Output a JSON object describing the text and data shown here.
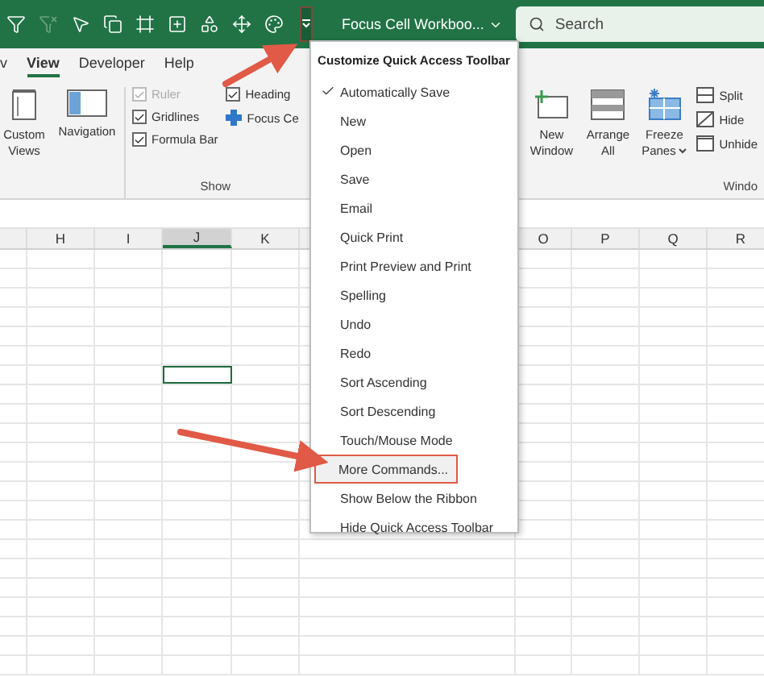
{
  "title_bar": {
    "customize_button": {
      "selected": true
    },
    "title": "Focus Cell Workboo...",
    "search": {
      "placeholder": "Search"
    }
  },
  "tabs": [
    {
      "label": "v",
      "selected": false
    },
    {
      "label": "View",
      "selected": true
    },
    {
      "label": "Developer",
      "selected": false
    },
    {
      "label": "Help",
      "selected": false
    }
  ],
  "ribbon": {
    "left_buttons": [
      {
        "label": "Custom Views",
        "kind": "views"
      },
      {
        "label": "Navigation",
        "kind": "navigation"
      }
    ],
    "show_checks": [
      {
        "label": "Ruler",
        "checked": true,
        "disabled": true
      },
      {
        "label": "Gridlines",
        "checked": true,
        "disabled": false
      },
      {
        "label": "Formula Bar",
        "checked": true,
        "disabled": false
      }
    ],
    "show_extra": [
      {
        "label": "Heading",
        "kind": "checkbox",
        "checked": true
      },
      {
        "label": "Focus Ce",
        "kind": "addin"
      }
    ],
    "show_group_label": "Show",
    "window_buttons": [
      {
        "label": "New Window",
        "kind": "new"
      },
      {
        "label": "Arrange All",
        "kind": "arrange"
      },
      {
        "label": "Freeze Panes",
        "kind": "freeze",
        "dropdown": true
      }
    ],
    "window_small": [
      {
        "label": "Split",
        "kind": "split"
      },
      {
        "label": "Hide",
        "kind": "hide"
      },
      {
        "label": "Unhide",
        "kind": "unhide"
      }
    ],
    "window_group_label": "Windo"
  },
  "sheet": {
    "columns_left": [
      {
        "label": "H",
        "selected": false
      },
      {
        "label": "I",
        "selected": false
      },
      {
        "label": "J",
        "selected": true
      },
      {
        "label": "K",
        "selected": false
      }
    ],
    "columns_right": [
      {
        "label": "O",
        "selected": false
      },
      {
        "label": "P",
        "selected": false
      },
      {
        "label": "Q",
        "selected": false
      },
      {
        "label": "R",
        "selected": false
      }
    ],
    "rows": [
      {
        "selected": false
      },
      {
        "selected": false
      },
      {
        "selected": false
      },
      {
        "selected": false
      },
      {
        "selected": false
      },
      {
        "selected": false
      },
      {
        "selected": true
      },
      {
        "selected": false
      },
      {
        "selected": false
      },
      {
        "selected": false
      },
      {
        "selected": false
      },
      {
        "selected": false
      },
      {
        "selected": false
      },
      {
        "selected": false
      },
      {
        "selected": false
      },
      {
        "selected": false
      },
      {
        "selected": false
      },
      {
        "selected": false
      },
      {
        "selected": false
      },
      {
        "selected": false
      },
      {
        "selected": false
      },
      {
        "selected": false
      }
    ]
  },
  "menu": {
    "title": "Customize Quick Access Toolbar",
    "items": [
      {
        "label": "Automatically Save",
        "checked": true,
        "highlighted": false
      },
      {
        "label": "New",
        "checked": false,
        "highlighted": false
      },
      {
        "label": "Open",
        "checked": false,
        "highlighted": false
      },
      {
        "label": "Save",
        "checked": false,
        "highlighted": false
      },
      {
        "label": "Email",
        "checked": false,
        "highlighted": false
      },
      {
        "label": "Quick Print",
        "checked": false,
        "highlighted": false
      },
      {
        "label": "Print Preview and Print",
        "checked": false,
        "highlighted": false
      },
      {
        "label": "Spelling",
        "checked": false,
        "highlighted": false
      },
      {
        "label": "Undo",
        "checked": false,
        "highlighted": false
      },
      {
        "label": "Redo",
        "checked": false,
        "highlighted": false
      },
      {
        "label": "Sort Ascending",
        "checked": false,
        "highlighted": false
      },
      {
        "label": "Sort Descending",
        "checked": false,
        "highlighted": false
      },
      {
        "label": "Touch/Mouse Mode",
        "checked": false,
        "highlighted": false
      },
      {
        "label": "More Commands...",
        "checked": false,
        "highlighted": true
      },
      {
        "label": "Show Below the Ribbon",
        "checked": false,
        "highlighted": false
      },
      {
        "label": "Hide Quick Access Toolbar",
        "checked": false,
        "highlighted": false
      }
    ]
  }
}
